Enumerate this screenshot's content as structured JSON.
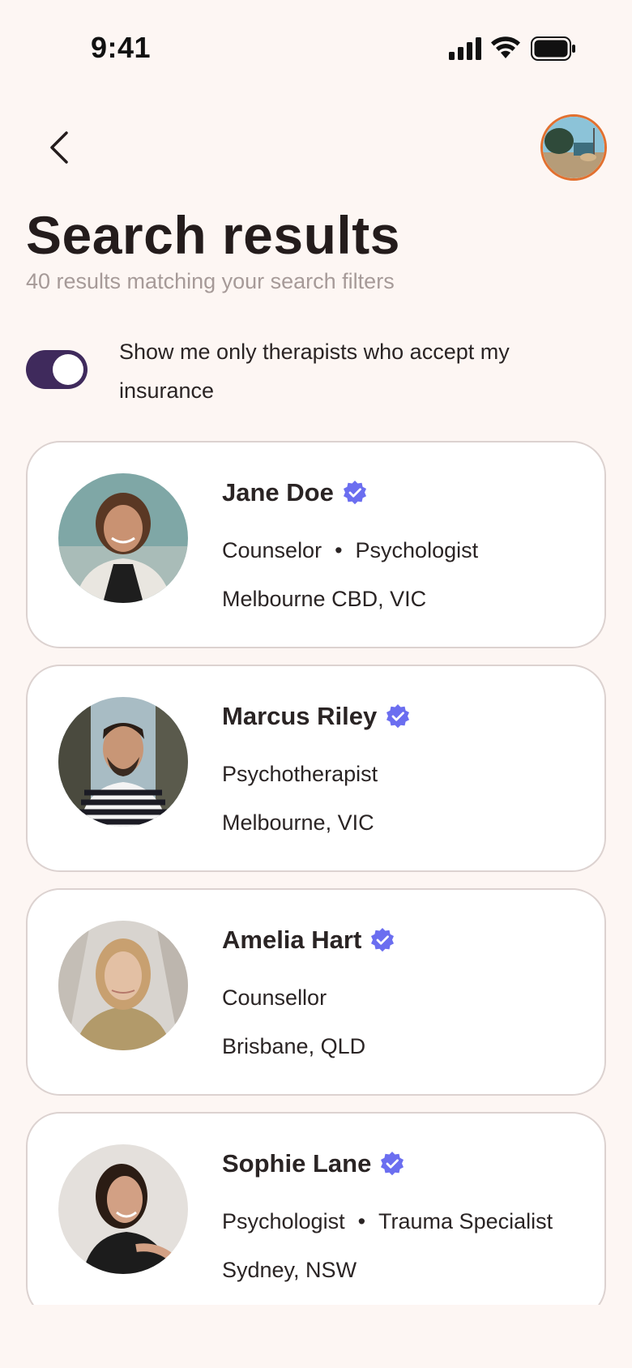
{
  "status_bar": {
    "time": "9:41"
  },
  "header": {
    "title": "Search results",
    "subtitle": "40 results matching your search filters"
  },
  "filter": {
    "insurance_label": "Show me only therapists who accept my insurance",
    "insurance_enabled": true
  },
  "results": [
    {
      "name": "Jane Doe",
      "role_1": "Counselor",
      "separator": "•",
      "role_2": "Psychologist",
      "location": "Melbourne CBD, VIC",
      "verified": true
    },
    {
      "name": "Marcus Riley",
      "role_1": "Psychotherapist",
      "location": "Melbourne, VIC",
      "verified": true
    },
    {
      "name": "Amelia Hart",
      "role_1": "Counsellor",
      "location": "Brisbane, QLD",
      "verified": true
    },
    {
      "name": "Sophie Lane",
      "role_1": "Psychologist",
      "separator": "•",
      "role_2": "Trauma Specialist",
      "location": "Sydney, NSW",
      "verified": true
    }
  ],
  "colors": {
    "background": "#fdf6f3",
    "toggle_on": "#3f2a5c",
    "verified_badge": "#6b6ef0",
    "avatar_ring": "#e2702f"
  }
}
